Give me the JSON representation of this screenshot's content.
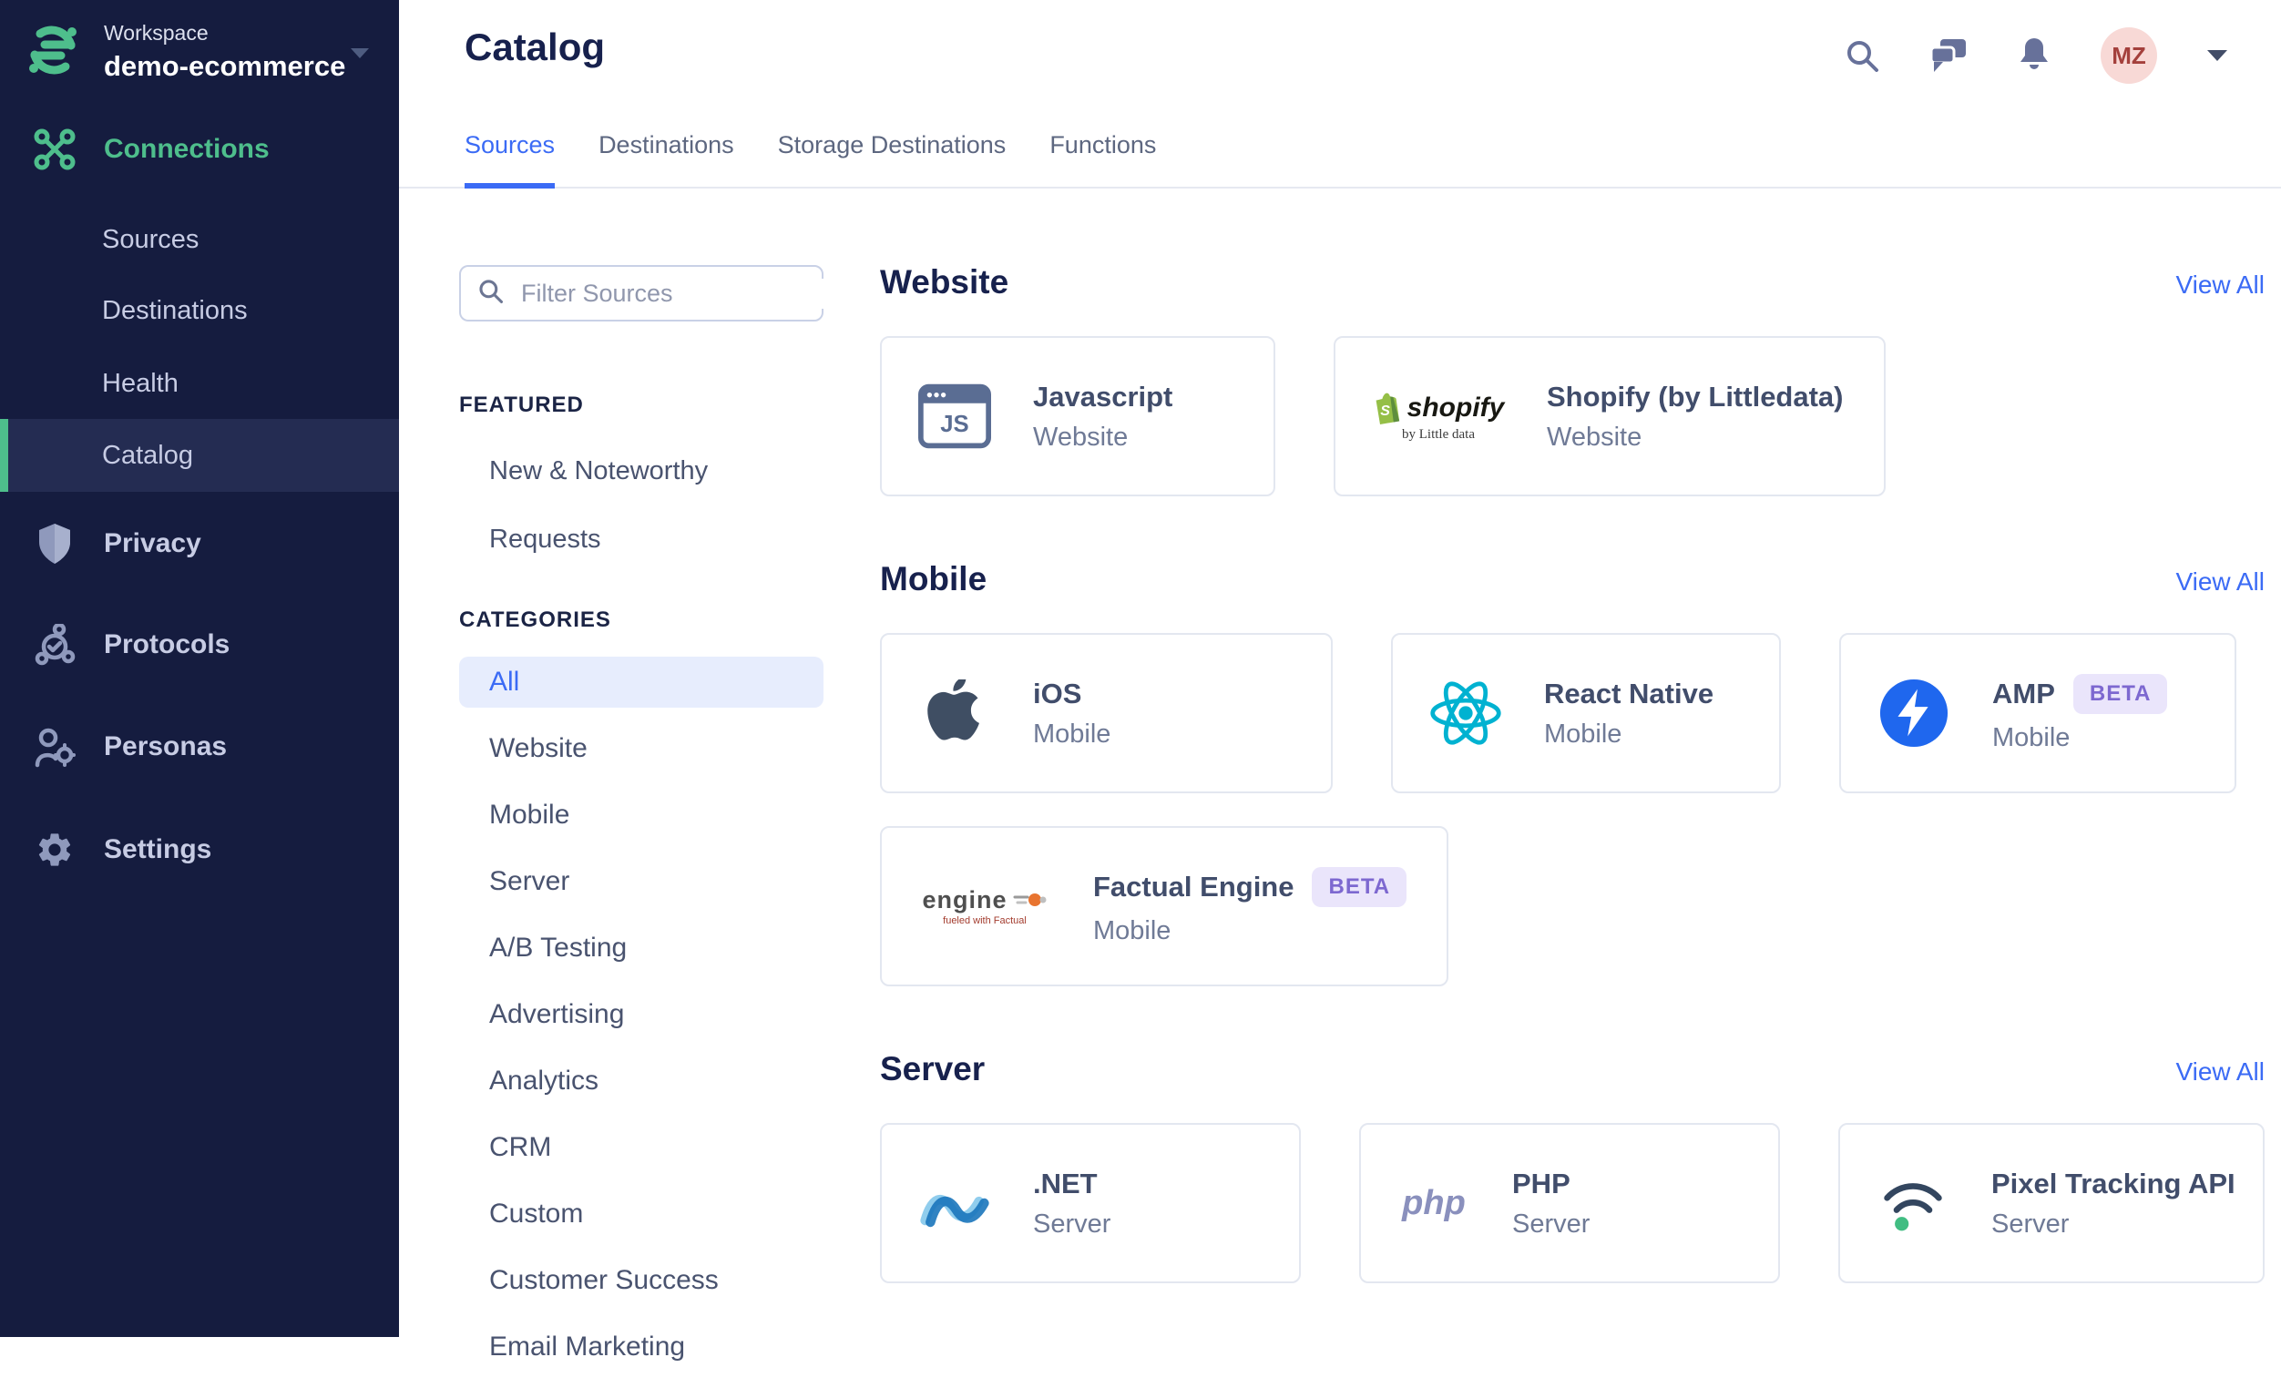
{
  "colors": {
    "accent_green": "#4EBE8C",
    "accent_blue": "#3B6BF5",
    "sidebar_bg": "#151C3F",
    "beta_purple": "#7D68D0",
    "avatar_pink": "#F8D9D6"
  },
  "sidebar": {
    "workspace_label": "Workspace",
    "workspace_name": "demo-ecommerce",
    "connections": {
      "label": "Connections"
    },
    "connections_sub": [
      {
        "label": "Sources"
      },
      {
        "label": "Destinations"
      },
      {
        "label": "Health"
      },
      {
        "label": "Catalog",
        "active": true
      }
    ],
    "items": [
      {
        "label": "Privacy",
        "icon": "shield-icon"
      },
      {
        "label": "Protocols",
        "icon": "protocols-icon"
      },
      {
        "label": "Personas",
        "icon": "personas-icon"
      },
      {
        "label": "Settings",
        "icon": "gear-icon"
      }
    ]
  },
  "header": {
    "title": "Catalog",
    "tabs": [
      {
        "label": "Sources",
        "active": true
      },
      {
        "label": "Destinations",
        "active": false
      },
      {
        "label": "Storage Destinations",
        "active": false
      },
      {
        "label": "Functions",
        "active": false
      }
    ],
    "avatar_initials": "MZ"
  },
  "filters": {
    "placeholder": "Filter Sources",
    "featured_heading": "FEATURED",
    "featured_items": [
      "New & Noteworthy",
      "Requests"
    ],
    "categories_heading": "CATEGORIES",
    "active_category": "All",
    "categories": [
      "All",
      "Website",
      "Mobile",
      "Server",
      "A/B Testing",
      "Advertising",
      "Analytics",
      "CRM",
      "Custom",
      "Customer Success",
      "Email Marketing"
    ]
  },
  "catalog": {
    "sections": [
      {
        "title": "Website",
        "view_all": "View All",
        "cards": [
          {
            "name": "Javascript",
            "category": "Website",
            "icon": "javascript-browser-icon",
            "logo_text": "JS"
          },
          {
            "name": "Shopify (by Littledata)",
            "category": "Website",
            "icon": "shopify-icon",
            "logo_text": "shopify",
            "logo_subtext": "by Little data"
          }
        ]
      },
      {
        "title": "Mobile",
        "view_all": "View All",
        "cards": [
          {
            "name": "iOS",
            "category": "Mobile",
            "icon": "apple-icon"
          },
          {
            "name": "React Native",
            "category": "Mobile",
            "icon": "react-icon"
          },
          {
            "name": "AMP",
            "category": "Mobile",
            "icon": "amp-icon",
            "badge": "BETA"
          },
          {
            "name": "Factual Engine",
            "category": "Mobile",
            "icon": "factual-engine-icon",
            "badge": "BETA",
            "logo_text": "engine",
            "logo_subtext": "fueled with Factual"
          }
        ]
      },
      {
        "title": "Server",
        "view_all": "View All",
        "cards": [
          {
            "name": ".NET",
            "category": "Server",
            "icon": "dotnet-icon"
          },
          {
            "name": "PHP",
            "category": "Server",
            "icon": "php-icon",
            "logo_text": "php"
          },
          {
            "name": "Pixel Tracking API",
            "category": "Server",
            "icon": "pixel-tracking-icon"
          }
        ]
      }
    ]
  }
}
